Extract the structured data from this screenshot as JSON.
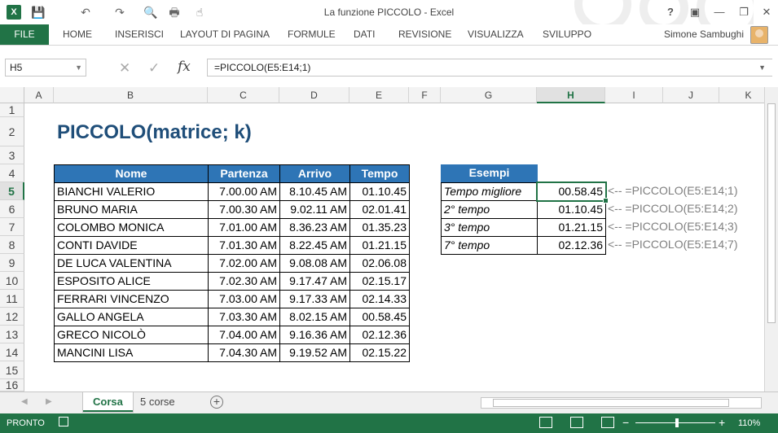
{
  "window": {
    "title": "La funzione PICCOLO - Excel",
    "help": "?",
    "ribbon_display": "▣",
    "minimize": "—",
    "restore": "❐",
    "close": "✕"
  },
  "qat": {
    "save": "💾",
    "undo": "↶",
    "redo": "↷",
    "preview": "🔍",
    "print": "🖶",
    "touch": "☝"
  },
  "ribbon": {
    "file": "FILE",
    "tabs": [
      "HOME",
      "INSERISCI",
      "LAYOUT DI PAGINA",
      "FORMULE",
      "DATI",
      "REVISIONE",
      "VISUALIZZA",
      "SVILUPPO"
    ],
    "user": "Simone Sambughi"
  },
  "formula_bar": {
    "name_box": "H5",
    "formula": "=PICCOLO(E5:E14;1)",
    "fx": "fx",
    "cancel": "✕",
    "enter": "✓"
  },
  "columns": [
    "A",
    "B",
    "C",
    "D",
    "E",
    "F",
    "G",
    "H",
    "I",
    "J",
    "K"
  ],
  "rows": [
    "1",
    "2",
    "3",
    "4",
    "5",
    "6",
    "7",
    "8",
    "9",
    "10",
    "11",
    "12",
    "13",
    "14",
    "15",
    "16"
  ],
  "sheet": {
    "title": "PICCOLO(matrice; k)",
    "table_headers": [
      "Nome",
      "Partenza",
      "Arrivo",
      "Tempo"
    ],
    "table_rows": [
      [
        "BIANCHI VALERIO",
        "7.00.00 AM",
        "8.10.45 AM",
        "01.10.45"
      ],
      [
        "BRUNO MARIA",
        "7.00.30 AM",
        "9.02.11 AM",
        "02.01.41"
      ],
      [
        "COLOMBO MONICA",
        "7.01.00 AM",
        "8.36.23 AM",
        "01.35.23"
      ],
      [
        "CONTI DAVIDE",
        "7.01.30 AM",
        "8.22.45 AM",
        "01.21.15"
      ],
      [
        "DE LUCA VALENTINA",
        "7.02.00 AM",
        "9.08.08 AM",
        "02.06.08"
      ],
      [
        "ESPOSITO ALICE",
        "7.02.30 AM",
        "9.17.47 AM",
        "02.15.17"
      ],
      [
        "FERRARI VINCENZO",
        "7.03.00 AM",
        "9.17.33 AM",
        "02.14.33"
      ],
      [
        "GALLO ANGELA",
        "7.03.30 AM",
        "8.02.15 AM",
        "00.58.45"
      ],
      [
        "GRECO NICOLÒ",
        "7.04.00 AM",
        "9.16.36 AM",
        "02.12.36"
      ],
      [
        "MANCINI LISA",
        "7.04.30 AM",
        "9.19.52 AM",
        "02.15.22"
      ]
    ],
    "examples_header": "Esempi",
    "examples": [
      {
        "label": "Tempo migliore",
        "value": "00.58.45",
        "note": "<-- =PICCOLO(E5:E14;1)"
      },
      {
        "label": "2° tempo",
        "value": "01.10.45",
        "note": "<-- =PICCOLO(E5:E14;2)"
      },
      {
        "label": "3° tempo",
        "value": "01.21.15",
        "note": "<-- =PICCOLO(E5:E14;3)"
      },
      {
        "label": "7° tempo",
        "value": "02.12.36",
        "note": "<-- =PICCOLO(E5:E14;7)"
      }
    ]
  },
  "sheet_tabs": [
    "Corsa",
    "5 corse"
  ],
  "status": {
    "ready": "PRONTO",
    "zoom": "110%"
  }
}
